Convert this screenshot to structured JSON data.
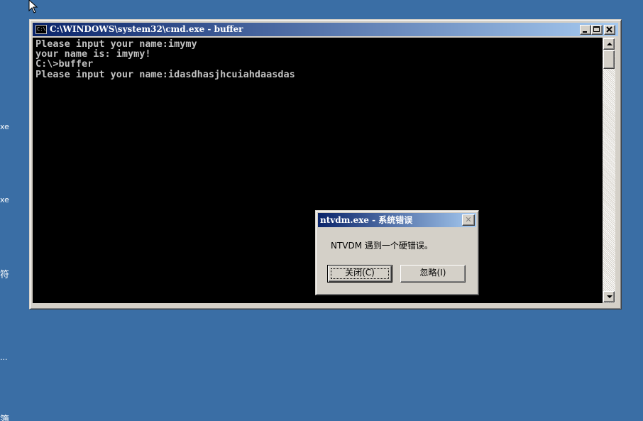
{
  "desktop": {
    "fragments": [
      {
        "id": "frag-1",
        "text": "xe"
      },
      {
        "id": "frag-2",
        "text": "xe"
      },
      {
        "id": "frag-3",
        "text": "符"
      },
      {
        "id": "frag-4",
        "text": "..."
      },
      {
        "id": "frag-5",
        "text": "簿"
      }
    ]
  },
  "cmd_window": {
    "icon_text": "C:\\",
    "title": "C:\\WINDOWS\\system32\\cmd.exe - buffer",
    "console_lines": [
      "Please input your name:imymy",
      "your name is: imymy!",
      "C:\\>buffer",
      "Please input your name:idasdhasjhcuiahdaasdas"
    ]
  },
  "error_dialog": {
    "title": "ntvdm.exe - 系统错误",
    "close_glyph": "✕",
    "message": "NTVDM 遇到一个硬错误。",
    "buttons": {
      "close": "关闭(C)",
      "ignore": "忽略(I)"
    }
  },
  "colors": {
    "desktop": "#3a6ea5",
    "titlebar_start": "#0a246a",
    "titlebar_end": "#a6caf0",
    "console_bg": "#000000",
    "console_text": "#c0c0c0",
    "chrome": "#d4d0c8"
  }
}
